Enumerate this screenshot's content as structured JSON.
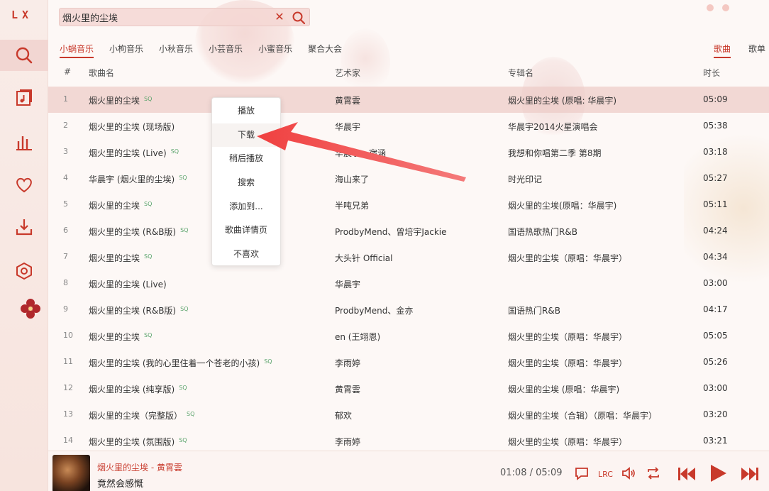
{
  "app": {
    "logo": "LX"
  },
  "search": {
    "value": "烟火里的尘埃"
  },
  "source_tabs": [
    "小蜗音乐",
    "小枸音乐",
    "小秋音乐",
    "小芸音乐",
    "小蜜音乐",
    "聚合大会"
  ],
  "type_tabs": {
    "songs": "歌曲",
    "playlists": "歌单"
  },
  "columns": {
    "index": "#",
    "name": "歌曲名",
    "artist": "艺术家",
    "album": "专辑名",
    "duration": "时长"
  },
  "rows": [
    {
      "idx": "1",
      "name": "烟火里的尘埃",
      "sq": "SQ",
      "artist": "黄霄雲",
      "album": "烟火里的尘埃 (原唱: 华晨宇)",
      "time": "05:09"
    },
    {
      "idx": "2",
      "name": "烟火里的尘埃 (现场版)",
      "sq": "",
      "artist": "华晨宇",
      "album": "华晨宇2014火星演唱会",
      "time": "05:38"
    },
    {
      "idx": "3",
      "name": "烟火里的尘埃 (Live)",
      "sq": "SQ",
      "artist": "华晨宇、宿涵",
      "album": "我想和你唱第二季 第8期",
      "time": "03:18"
    },
    {
      "idx": "4",
      "name": "华晨宇 (烟火里的尘埃)",
      "sq": "SQ",
      "artist": "海山来了",
      "album": "时光印记",
      "time": "05:27"
    },
    {
      "idx": "5",
      "name": "烟火里的尘埃",
      "sq": "SQ",
      "artist": "半吨兄弟",
      "album": "烟火里的尘埃(原唱：华晨宇)",
      "time": "05:11"
    },
    {
      "idx": "6",
      "name": "烟火里的尘埃 (R&B版)",
      "sq": "SQ",
      "artist": "ProdbyMend、曾培宇Jackie",
      "album": "国语热歌热门R&B",
      "time": "04:24"
    },
    {
      "idx": "7",
      "name": "烟火里的尘埃",
      "sq": "SQ",
      "artist": "大头针 Official",
      "album": "烟火里的尘埃（原唱：华晨宇）",
      "time": "04:34"
    },
    {
      "idx": "8",
      "name": "烟火里的尘埃 (Live)",
      "sq": "",
      "artist": "华晨宇",
      "album": "",
      "time": "03:00"
    },
    {
      "idx": "9",
      "name": "烟火里的尘埃 (R&B版)",
      "sq": "SQ",
      "artist": "ProdbyMend、金亦",
      "album": "国语热门R&B",
      "time": "04:17"
    },
    {
      "idx": "10",
      "name": "烟火里的尘埃",
      "sq": "SQ",
      "artist": "en (王翊恩)",
      "album": "烟火里的尘埃（原唱：华晨宇）",
      "time": "05:05"
    },
    {
      "idx": "11",
      "name": "烟火里的尘埃 (我的心里住着一个苍老的小孩)",
      "sq": "SQ",
      "artist": "李雨婷",
      "album": "烟火里的尘埃（原唱：华晨宇）",
      "time": "05:26"
    },
    {
      "idx": "12",
      "name": "烟火里的尘埃 (纯享版)",
      "sq": "SQ",
      "artist": "黄霄雲",
      "album": "烟火里的尘埃 (原唱：华晨宇)",
      "time": "03:00"
    },
    {
      "idx": "13",
      "name": "烟火里的尘埃（完整版）",
      "sq": "SQ",
      "artist": "郁欢",
      "album": "烟火里的尘埃（合辑）（原唱：华晨宇）",
      "time": "03:20"
    },
    {
      "idx": "14",
      "name": "烟火里的尘埃 (氛围版)",
      "sq": "SQ",
      "artist": "李雨婷",
      "album": "烟火里的尘埃（原唱：华晨宇）",
      "time": "03:21"
    }
  ],
  "context_menu": [
    "播放",
    "下载",
    "稍后播放",
    "搜索",
    "添加到...",
    "歌曲详情页",
    "不喜欢"
  ],
  "player": {
    "title": "烟火里的尘埃 - 黄霄雲",
    "lyric": "竟然会感慨",
    "time": "01:08 / 05:09"
  },
  "colors": {
    "accent": "#c8392b",
    "selected_row": "#ecccc6",
    "annotation_arrow": "#f04f4f"
  }
}
